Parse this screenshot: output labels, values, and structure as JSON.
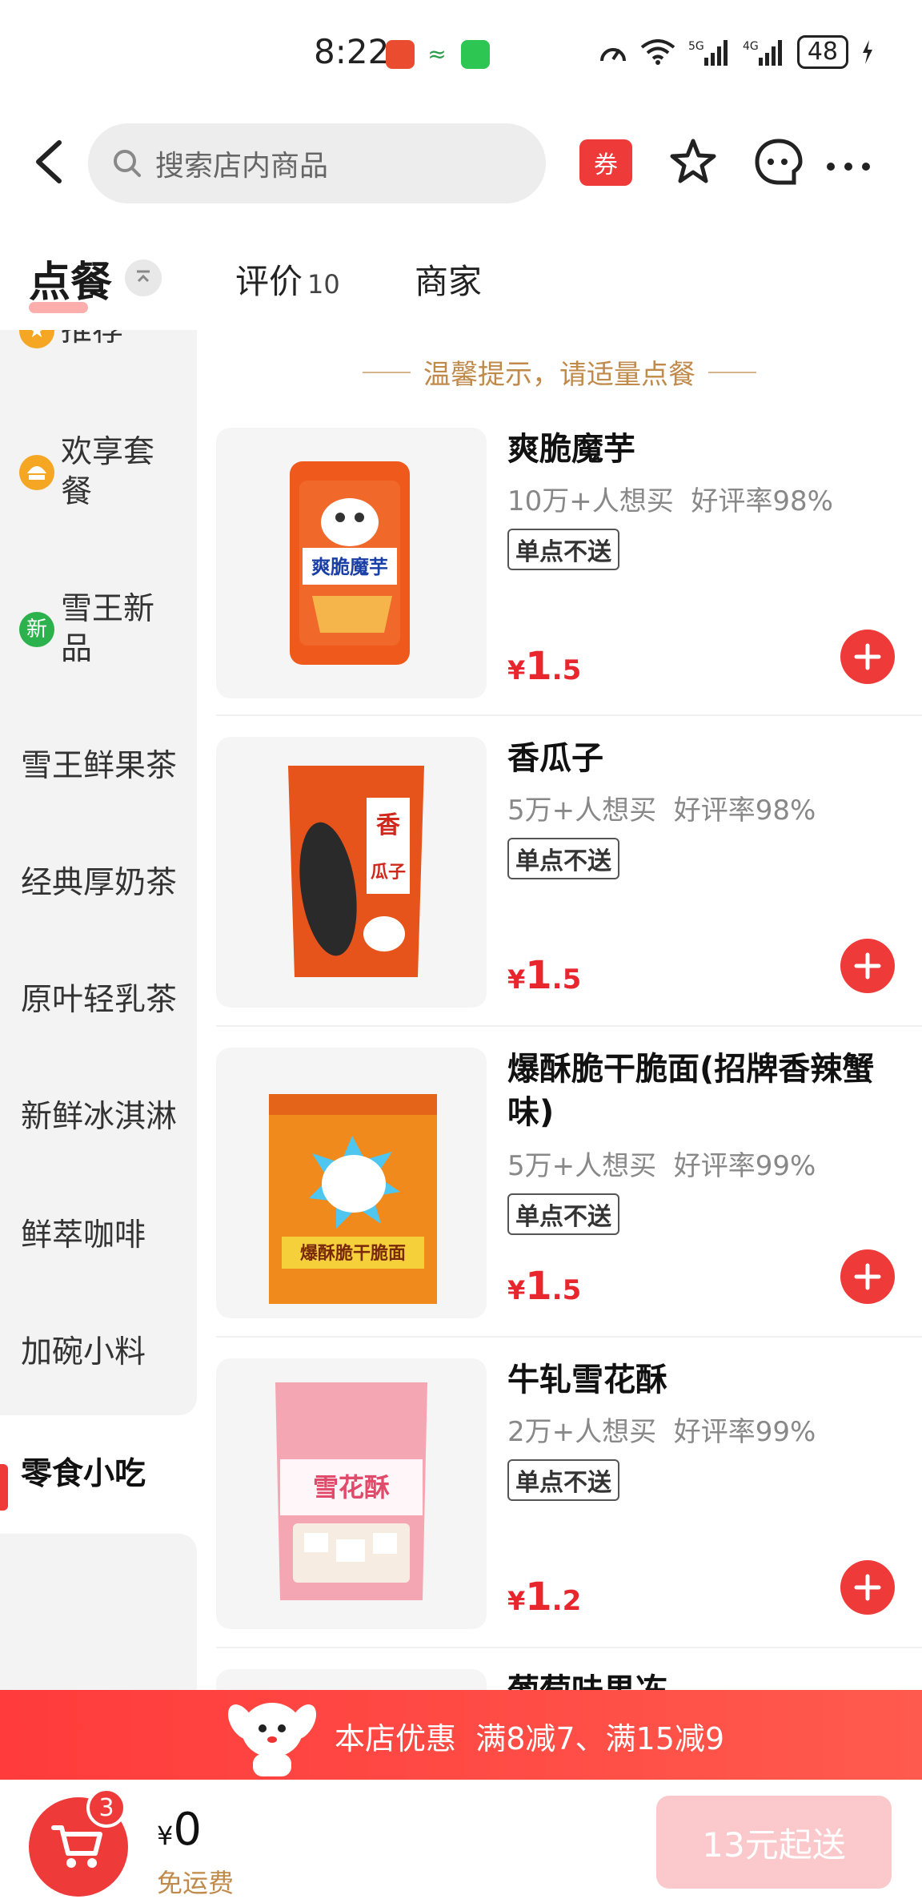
{
  "status_bar": {
    "time": "8:22",
    "battery": "48",
    "network": "5G 4G"
  },
  "header": {
    "search_placeholder": "搜索店内商品",
    "coupon_label": "券"
  },
  "tabs": {
    "main": "点餐",
    "reviews": "评价",
    "reviews_count": "10",
    "merchant": "商家"
  },
  "sidebar": {
    "items": [
      {
        "label": "推荐",
        "badge": "★"
      },
      {
        "label": "欢享套餐",
        "badge": ""
      },
      {
        "label": "雪王新品",
        "badge": "新"
      },
      {
        "label": "雪王鲜果茶"
      },
      {
        "label": "经典厚奶茶"
      },
      {
        "label": "原叶轻乳茶"
      },
      {
        "label": "新鲜冰淇淋"
      },
      {
        "label": "鲜萃咖啡"
      },
      {
        "label": "加碗小料"
      },
      {
        "label": "零食小吃"
      }
    ]
  },
  "hint": "温馨提示，请适量点餐",
  "products": [
    {
      "name": "爽脆魔芋",
      "sales": "10万+人想买",
      "rating": "好评率98%",
      "tag": "单点不送",
      "currency": "¥",
      "price_int": "1",
      "price_dec": ".5",
      "pack_text": "爽脆魔芋"
    },
    {
      "name": "香瓜子",
      "sales": "5万+人想买",
      "rating": "好评率98%",
      "tag": "单点不送",
      "currency": "¥",
      "price_int": "1",
      "price_dec": ".5",
      "pack_text": "香瓜子"
    },
    {
      "name": "爆酥脆干脆面(招牌香辣蟹味)",
      "sales": "5万+人想买",
      "rating": "好评率99%",
      "tag": "单点不送",
      "currency": "¥",
      "price_int": "1",
      "price_dec": ".5",
      "pack_text": "爆酥脆干脆面"
    },
    {
      "name": "牛轧雪花酥",
      "sales": "2万+人想买",
      "rating": "好评率99%",
      "tag": "单点不送",
      "currency": "¥",
      "price_int": "1",
      "price_dec": ".2",
      "pack_text": "雪花酥"
    },
    {
      "name": "葡萄味果冻"
    }
  ],
  "promo": {
    "label": "本店优惠",
    "deals": "满8减7、满15减9"
  },
  "cart": {
    "count": "3",
    "currency": "¥",
    "total": "0",
    "shipping": "免运费",
    "min_order": "13元起送"
  },
  "colors": {
    "accent": "#ef3a3a",
    "hint": "#c08a4a",
    "min_order_bg": "#fbc9cb"
  }
}
